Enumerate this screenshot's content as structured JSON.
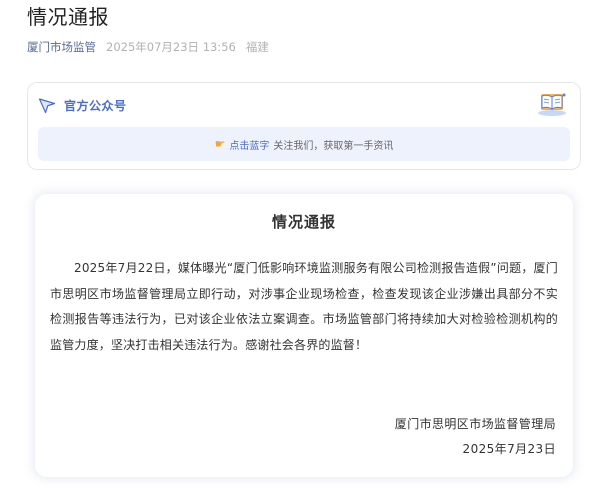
{
  "article": {
    "title": "情况通报",
    "account_name": "厦门市场监管",
    "publish_time": "2025年07月23日 13:56",
    "region": "福建"
  },
  "official_account_card": {
    "label": "官方公众号",
    "follow_link": "点击蓝字",
    "follow_text": "关注我们，获取第一手资讯",
    "icons": {
      "header": "paper-plane-icon",
      "book": "open-book-icon",
      "hand": "pointing-hand-icon"
    }
  },
  "notice": {
    "title": "情况通报",
    "body": "2025年7月22日，媒体曝光“厦门低影响环境监测服务有限公司检测报告造假”问题，厦门市思明区市场监督管理局立即行动，对涉事企业现场检查，检查发现该企业涉嫌出具部分不实检测报告等违法行为，已对该企业依法立案调查。市场监管部门将持续加大对检验检测机构的监管力度，坚决打击相关违法行为。感谢社会各界的监督！",
    "signature_org": "厦门市思明区市场监督管理局",
    "signature_date": "2025年7月23日"
  },
  "colors": {
    "link_blue": "#576b95",
    "accent_blue": "#4a6ec8",
    "follow_bar_bg": "#eef2fc",
    "meta_gray": "#b2b2b2"
  }
}
